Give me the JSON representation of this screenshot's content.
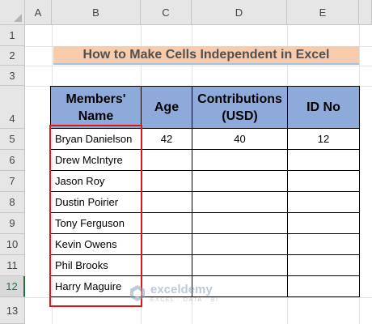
{
  "sheet": {
    "columns": [
      "A",
      "B",
      "C",
      "D",
      "E"
    ],
    "rows": [
      "1",
      "2",
      "3",
      "4",
      "5",
      "6",
      "7",
      "8",
      "9",
      "10",
      "11",
      "12",
      "13"
    ],
    "selected_row": "12"
  },
  "title": "How to Make Cells Independent in Excel",
  "table": {
    "headers": {
      "name": "Members' Name",
      "age": "Age",
      "contributions": "Contributions (USD)",
      "id": "ID No"
    },
    "rows": [
      {
        "name": "Bryan Danielson",
        "age": "42",
        "contributions": "40",
        "id": "12"
      },
      {
        "name": "Drew McIntyre",
        "age": "",
        "contributions": "",
        "id": ""
      },
      {
        "name": "Jason Roy",
        "age": "",
        "contributions": "",
        "id": ""
      },
      {
        "name": "Dustin Poirier",
        "age": "",
        "contributions": "",
        "id": ""
      },
      {
        "name": "Tony Ferguson",
        "age": "",
        "contributions": "",
        "id": ""
      },
      {
        "name": "Kevin Owens",
        "age": "",
        "contributions": "",
        "id": ""
      },
      {
        "name": "Phil Brooks",
        "age": "",
        "contributions": "",
        "id": ""
      },
      {
        "name": "Harry Maguire",
        "age": "",
        "contributions": "",
        "id": ""
      }
    ]
  },
  "watermark": {
    "name": "exceldemy",
    "tagline": "EXCEL · DATA · BI"
  },
  "colors": {
    "title_fill": "#f8cbad",
    "header_fill": "#8eaadb",
    "highlight_border": "#e0151c"
  }
}
